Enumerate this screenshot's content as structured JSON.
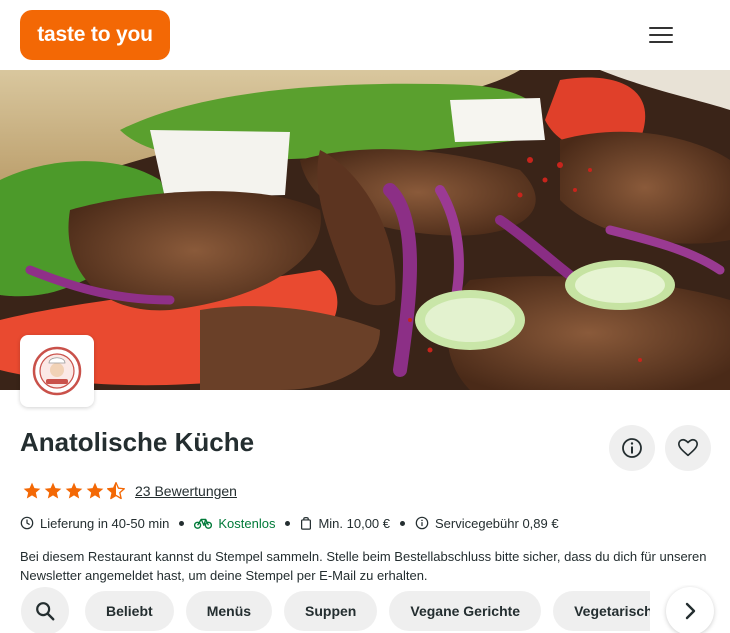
{
  "header": {
    "logo_text": "taste to you",
    "menu_icon": "hamburger-menu-icon"
  },
  "hero": {
    "image_description_icon": "food-photo"
  },
  "restaurant": {
    "name": "Anatolische Küche",
    "rating_value": 4.5,
    "rating_max": 5,
    "reviews_label": "23 Bewertungen",
    "delivery_time": "Lieferung in 40-50 min",
    "delivery_fee": "Kostenlos",
    "min_order": "Min. 10,00 €",
    "service_fee": "Servicegebühr 0,89 €",
    "description": "Bei diesem Restaurant kannst du Stempel sammeln. Stelle beim Bestellabschluss bitte sicher, dass du dich für unseren Newsletter angemeldet hast, um deine Stempel per E-Mail zu erhalten."
  },
  "categories": [
    "Beliebt",
    "Menüs",
    "Suppen",
    "Vegane Gerichte",
    "Vegetarische Gerichte"
  ],
  "colors": {
    "brand": "#f36805",
    "free_delivery": "#017a39",
    "chip_bg": "#efefef"
  }
}
